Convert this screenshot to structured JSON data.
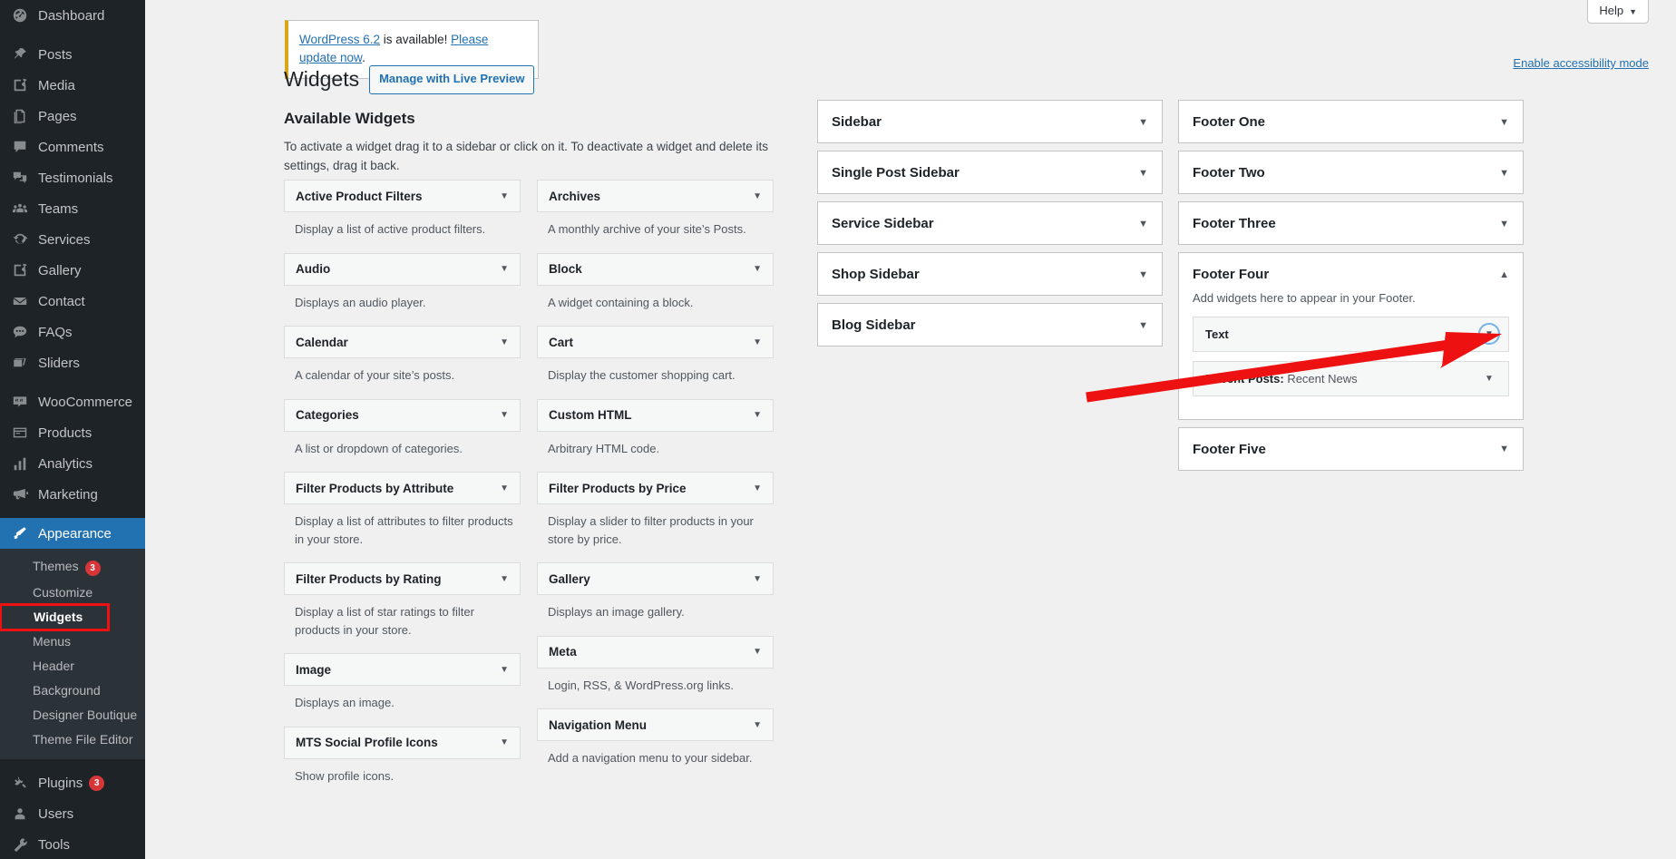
{
  "admin_menu": {
    "groups": [
      {
        "items": [
          {
            "label": "Dashboard",
            "icon": "dashboard-icon",
            "current": false
          }
        ]
      },
      {
        "items": [
          {
            "label": "Posts",
            "icon": "pin-icon",
            "current": false
          },
          {
            "label": "Media",
            "icon": "media-icon",
            "current": false
          },
          {
            "label": "Pages",
            "icon": "pages-icon",
            "current": false
          },
          {
            "label": "Comments",
            "icon": "comments-icon",
            "current": false
          },
          {
            "label": "Testimonials",
            "icon": "testimonials-icon",
            "current": false
          },
          {
            "label": "Teams",
            "icon": "teams-icon",
            "current": false
          },
          {
            "label": "Services",
            "icon": "services-icon",
            "current": false
          },
          {
            "label": "Gallery",
            "icon": "gallery-icon",
            "current": false
          },
          {
            "label": "Contact",
            "icon": "envelope-icon",
            "current": false
          },
          {
            "label": "FAQs",
            "icon": "faq-icon",
            "current": false
          },
          {
            "label": "Sliders",
            "icon": "sliders-icon",
            "current": false
          }
        ]
      },
      {
        "items": [
          {
            "label": "WooCommerce",
            "icon": "woocommerce-icon",
            "current": false
          },
          {
            "label": "Products",
            "icon": "products-icon",
            "current": false
          },
          {
            "label": "Analytics",
            "icon": "analytics-icon",
            "current": false
          },
          {
            "label": "Marketing",
            "icon": "marketing-icon",
            "current": false
          }
        ]
      },
      {
        "items": [
          {
            "label": "Appearance",
            "icon": "appearance-icon",
            "current": true
          }
        ]
      },
      {
        "items": [
          {
            "label": "Plugins",
            "icon": "plugins-icon",
            "current": false,
            "badge": "3"
          },
          {
            "label": "Users",
            "icon": "users-icon",
            "current": false
          },
          {
            "label": "Tools",
            "icon": "tools-icon",
            "current": false
          }
        ]
      }
    ],
    "appearance_submenu": [
      {
        "label": "Themes",
        "badge": "3",
        "active": false,
        "boxed": false
      },
      {
        "label": "Customize",
        "active": false,
        "boxed": false
      },
      {
        "label": "Widgets",
        "active": true,
        "boxed": true
      },
      {
        "label": "Menus",
        "active": false,
        "boxed": false
      },
      {
        "label": "Header",
        "active": false,
        "boxed": false
      },
      {
        "label": "Background",
        "active": false,
        "boxed": false
      },
      {
        "label": "Designer Boutique",
        "active": false,
        "boxed": false
      },
      {
        "label": "Theme File Editor",
        "active": false,
        "boxed": false
      }
    ]
  },
  "header": {
    "help_label": "Help",
    "help_caret": "▼",
    "accessibility_link": "Enable accessibility mode"
  },
  "update_nag": {
    "link_version": "WordPress 6.2",
    "middle_text": " is available! ",
    "link_update": "Please update now",
    "period": "."
  },
  "page": {
    "title": "Widgets",
    "live_preview_button": "Manage with Live Preview",
    "section_title": "Available Widgets",
    "section_desc": "To activate a widget drag it to a sidebar or click on it. To deactivate a widget and delete its settings, drag it back."
  },
  "available_widgets": {
    "caret": "▼",
    "left": [
      {
        "name": "Active Product Filters",
        "desc": "Display a list of active product filters."
      },
      {
        "name": "Audio",
        "desc": "Displays an audio player."
      },
      {
        "name": "Calendar",
        "desc": "A calendar of your site’s posts."
      },
      {
        "name": "Categories",
        "desc": "A list or dropdown of categories."
      },
      {
        "name": "Filter Products by Attribute",
        "desc": "Display a list of attributes to filter products in your store."
      },
      {
        "name": "Filter Products by Rating",
        "desc": "Display a list of star ratings to filter products in your store."
      },
      {
        "name": "Image",
        "desc": "Displays an image."
      },
      {
        "name": "MTS Social Profile Icons",
        "desc": "Show profile icons."
      }
    ],
    "right": [
      {
        "name": "Archives",
        "desc": "A monthly archive of your site’s Posts."
      },
      {
        "name": "Block",
        "desc": "A widget containing a block."
      },
      {
        "name": "Cart",
        "desc": "Display the customer shopping cart."
      },
      {
        "name": "Custom HTML",
        "desc": "Arbitrary HTML code."
      },
      {
        "name": "Filter Products by Price",
        "desc": "Display a slider to filter products in your store by price."
      },
      {
        "name": "Gallery",
        "desc": "Displays an image gallery."
      },
      {
        "name": "Meta",
        "desc": "Login, RSS, & WordPress.org links."
      },
      {
        "name": "Navigation Menu",
        "desc": "Add a navigation menu to your sidebar."
      }
    ]
  },
  "sidebars_column_1": [
    {
      "title": "Sidebar",
      "caret": "▼",
      "expanded": false
    },
    {
      "title": "Single Post Sidebar",
      "caret": "▼",
      "expanded": false
    },
    {
      "title": "Service Sidebar",
      "caret": "▼",
      "expanded": false
    },
    {
      "title": "Shop Sidebar",
      "caret": "▼",
      "expanded": false
    },
    {
      "title": "Blog Sidebar",
      "caret": "▼",
      "expanded": false
    }
  ],
  "sidebars_column_2": [
    {
      "title": "Footer One",
      "caret": "▼",
      "expanded": false
    },
    {
      "title": "Footer Two",
      "caret": "▼",
      "expanded": false
    },
    {
      "title": "Footer Three",
      "caret": "▼",
      "expanded": false
    },
    {
      "title": "Footer Four",
      "caret": "▲",
      "expanded": true,
      "desc": "Add widgets here to appear in your Footer.",
      "widgets": [
        {
          "title": "Text",
          "instance": "",
          "caret": "▼",
          "focused": true
        },
        {
          "title": "Recent Posts:",
          "instance": " Recent News",
          "caret": "▼",
          "focused": false
        }
      ]
    },
    {
      "title": "Footer Five",
      "caret": "▼",
      "expanded": false
    }
  ],
  "annotation": {
    "type": "red-arrow",
    "points_to": "Text widget in Footer Four",
    "color": "#ee1111"
  },
  "colors": {
    "admin_bg": "#1d2327",
    "submenu_bg": "#2c3338",
    "accent_blue": "#2271b1",
    "link_blue": "#2271b1",
    "page_bg": "#f0f0f1",
    "badge_red": "#d63638",
    "highlight_red": "#ee1111",
    "nag_yellow": "#dba617"
  }
}
